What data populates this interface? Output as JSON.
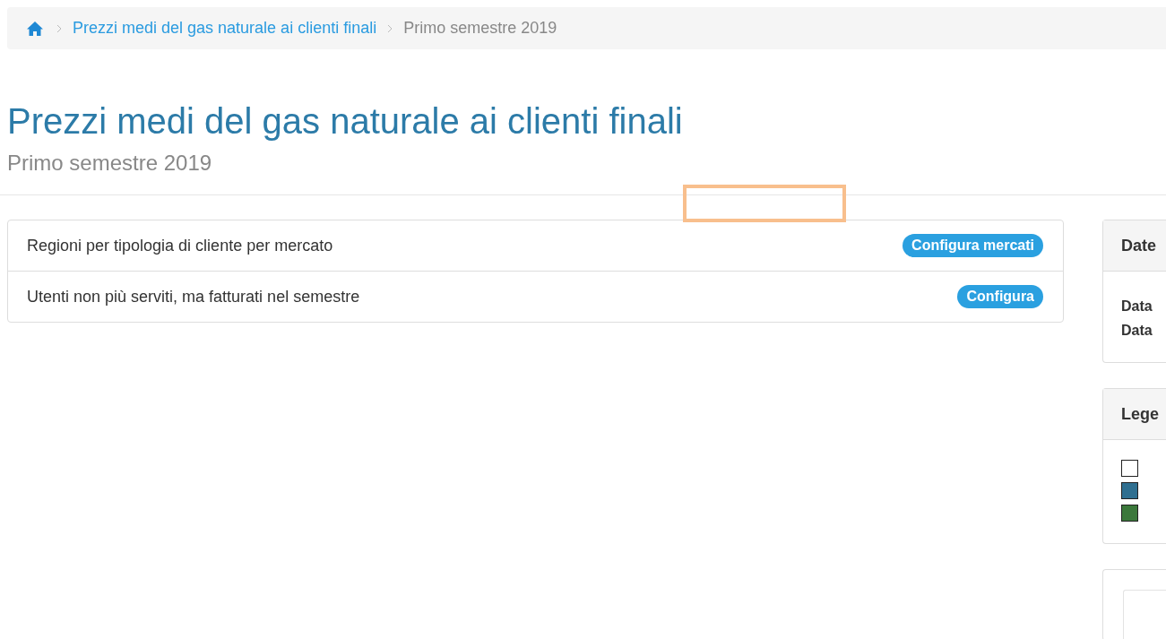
{
  "breadcrumb": {
    "items": [
      {
        "label": "Prezzi medi del gas naturale ai clienti finali",
        "kind": "link"
      },
      {
        "label": "Primo semestre 2019",
        "kind": "current"
      }
    ]
  },
  "title": "Prezzi medi del gas naturale ai clienti finali",
  "subtitle": "Primo semestre 2019",
  "sections": [
    {
      "label": "Regioni per tipologia di cliente per mercato",
      "button": "Configura mercati"
    },
    {
      "label": "Utenti non più serviti, ma fatturati nel semestre",
      "button": "Configura"
    }
  ],
  "dates_panel": {
    "heading": "Date",
    "lines": [
      "Data",
      "Data"
    ]
  },
  "legend_panel": {
    "heading": "Lege",
    "swatches": [
      {
        "color": "#ffffff"
      },
      {
        "color": "#2f6f90"
      },
      {
        "color": "#3b783b"
      }
    ]
  }
}
